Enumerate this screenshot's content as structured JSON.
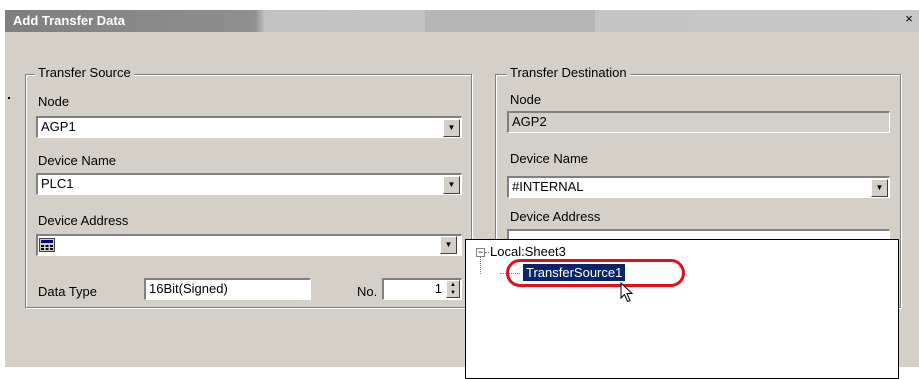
{
  "window": {
    "title": "Add Transfer Data",
    "close_glyph": "×"
  },
  "source": {
    "group_label": "Transfer Source",
    "node_label": "Node",
    "node_value": "AGP1",
    "device_name_label": "Device Name",
    "device_name_value": "PLC1",
    "device_address_label": "Device Address",
    "device_address_value": "",
    "data_type_label": "Data Type",
    "data_type_value": "16Bit(Signed)",
    "no_label": "No.",
    "no_value": "1"
  },
  "destination": {
    "group_label": "Transfer Destination",
    "node_label": "Node",
    "node_value": "AGP2",
    "device_name_label": "Device Name",
    "device_name_value": "#INTERNAL",
    "device_address_label": "Device Address"
  },
  "tree": {
    "root_label": "Local:Sheet3",
    "expander_glyph": "−",
    "child_label": "TransferSource1"
  },
  "colors": {
    "highlight_ring": "#e0101a",
    "selection": "#0a246a"
  }
}
